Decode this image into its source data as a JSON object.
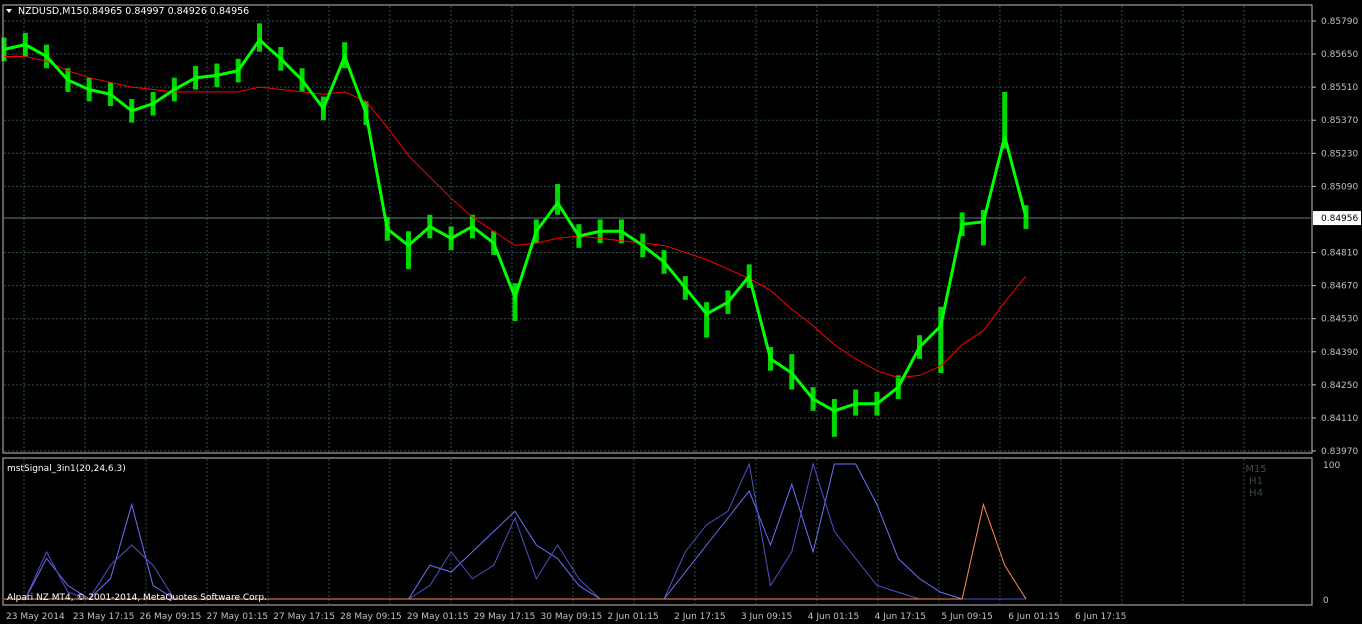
{
  "header": {
    "symbol": "NZDUSD,M15",
    "ohlc": "0.84965 0.84997 0.84926 0.84956"
  },
  "watermark": "Alpari NZ MT4, © 2001-2014, MetaQuotes Software Corp.",
  "colors": {
    "background": "#000000",
    "grid": "#2f4f4f",
    "axis": "#c0c0c0",
    "price_line": "#00ff00",
    "ma_line": "#ff0000",
    "ind_m15": "#6f6fff",
    "ind_h1": "#5050c8",
    "ind_h4": "#ff8c50",
    "label_gray": "#3a4a4a",
    "price_box": "#ffffff"
  },
  "chart_data": [
    {
      "type": "line",
      "symbol": "NZDUSD",
      "timeframe": "M15",
      "current_price": "0.84956",
      "ylim": [
        0.8397,
        0.8579
      ],
      "y_ticks": [
        "0.85790",
        "0.85650",
        "0.85510",
        "0.85370",
        "0.85230",
        "0.85090",
        "0.84810",
        "0.84670",
        "0.84530",
        "0.84390",
        "0.84250",
        "0.84110",
        "0.83970"
      ],
      "x_ticks": [
        "23 May 2014",
        "23 May 17:15",
        "26 May 09:15",
        "27 May 01:15",
        "27 May 17:15",
        "28 May 09:15",
        "29 May 01:15",
        "29 May 17:15",
        "30 May 09:15",
        "2 Jun 01:15",
        "2 Jun 17:15",
        "3 Jun 09:15",
        "4 Jun 01:15",
        "4 Jun 17:15",
        "5 Jun 09:15",
        "6 Jun 01:15",
        "6 Jun 17:15"
      ],
      "x": [
        0,
        5,
        10,
        15,
        20,
        25,
        30,
        35,
        40,
        45,
        50,
        55,
        60,
        65,
        70,
        75,
        80,
        85,
        90,
        95,
        100,
        105,
        110,
        115,
        120,
        125,
        130,
        135,
        140,
        145,
        150,
        155,
        160,
        165,
        170,
        175,
        180,
        185,
        190,
        195,
        200,
        205,
        210,
        215,
        220,
        225,
        230,
        235,
        240
      ],
      "series": [
        {
          "values": [
            0.8567,
            0.8569,
            0.8564,
            0.8554,
            0.855,
            0.8548,
            0.8541,
            0.8544,
            0.855,
            0.8555,
            0.8556,
            0.8558,
            0.8571,
            0.8563,
            0.8554,
            0.8542,
            0.8564,
            0.854,
            0.8491,
            0.8484,
            0.8492,
            0.8487,
            0.8492,
            0.8485,
            0.8462,
            0.849,
            0.8502,
            0.8488,
            0.849,
            0.849,
            0.8484,
            0.8477,
            0.8466,
            0.8455,
            0.846,
            0.8471,
            0.8436,
            0.843,
            0.8419,
            0.8414,
            0.8417,
            0.8417,
            0.8424,
            0.8441,
            0.845,
            0.8493,
            0.8494,
            0.853,
            0.8496
          ],
          "high": [
            0.8572,
            0.8574,
            0.8569,
            0.8559,
            0.8555,
            0.8553,
            0.8546,
            0.8549,
            0.8555,
            0.856,
            0.8561,
            0.8563,
            0.8578,
            0.8568,
            0.8559,
            0.8547,
            0.857,
            0.8545,
            0.8496,
            0.849,
            0.8497,
            0.8492,
            0.8497,
            0.849,
            0.8468,
            0.8495,
            0.851,
            0.8493,
            0.8495,
            0.8495,
            0.8489,
            0.8482,
            0.8471,
            0.846,
            0.8465,
            0.8476,
            0.8441,
            0.8438,
            0.8424,
            0.8419,
            0.8423,
            0.8422,
            0.8429,
            0.8446,
            0.8458,
            0.8498,
            0.8499,
            0.8549,
            0.8501
          ],
          "low": [
            0.8562,
            0.8564,
            0.8559,
            0.8549,
            0.8545,
            0.8543,
            0.8536,
            0.8539,
            0.8545,
            0.855,
            0.8551,
            0.8553,
            0.8566,
            0.8558,
            0.8549,
            0.8537,
            0.8559,
            0.8535,
            0.8486,
            0.8474,
            0.8487,
            0.8482,
            0.8487,
            0.848,
            0.8452,
            0.8485,
            0.8497,
            0.8483,
            0.8485,
            0.8485,
            0.8479,
            0.8472,
            0.8461,
            0.8445,
            0.8455,
            0.8466,
            0.8431,
            0.8423,
            0.8414,
            0.8403,
            0.8412,
            0.8412,
            0.8419,
            0.8436,
            0.843,
            0.8488,
            0.8484,
            0.8525,
            0.8491
          ]
        },
        {
          "values": [
            0.8564,
            0.8564,
            0.8562,
            0.8558,
            0.8555,
            0.8553,
            0.8551,
            0.855,
            0.8549,
            0.8549,
            0.8549,
            0.8549,
            0.8551,
            0.855,
            0.8549,
            0.8548,
            0.8549,
            0.8545,
            0.8534,
            0.8522,
            0.8513,
            0.8504,
            0.8496,
            0.849,
            0.8484,
            0.8485,
            0.8487,
            0.8488,
            0.8487,
            0.8486,
            0.8485,
            0.8484,
            0.8481,
            0.8478,
            0.8474,
            0.847,
            0.8465,
            0.8457,
            0.845,
            0.8442,
            0.8436,
            0.8431,
            0.8428,
            0.8429,
            0.8433,
            0.8442,
            0.8448,
            0.846,
            0.8471
          ]
        }
      ]
    },
    {
      "type": "line",
      "title": "mstSignal_3in1(20,24,6.3)",
      "ylim": [
        0,
        100
      ],
      "y_ticks": [
        "100",
        "0"
      ],
      "legend": [
        "M15",
        "H1",
        "H4"
      ],
      "x": [
        0,
        5,
        10,
        15,
        20,
        25,
        30,
        35,
        40,
        45,
        50,
        55,
        60,
        65,
        70,
        75,
        80,
        85,
        90,
        95,
        100,
        105,
        110,
        115,
        120,
        125,
        130,
        135,
        140,
        145,
        150,
        155,
        160,
        165,
        170,
        175,
        180,
        185,
        190,
        195,
        200,
        205,
        210,
        215,
        220,
        225,
        230,
        235,
        240
      ],
      "series": [
        {
          "name": "M15",
          "values": [
            0,
            0,
            30,
            10,
            0,
            15,
            70,
            10,
            0,
            0,
            0,
            0,
            0,
            0,
            0,
            0,
            0,
            0,
            0,
            0,
            25,
            20,
            35,
            50,
            65,
            40,
            30,
            10,
            0,
            0,
            0,
            0,
            20,
            40,
            60,
            80,
            40,
            85,
            35,
            100,
            100,
            70,
            30,
            15,
            5,
            0,
            0,
            0,
            0
          ]
        },
        {
          "name": "H1",
          "values": [
            0,
            0,
            35,
            5,
            0,
            25,
            40,
            25,
            0,
            0,
            0,
            0,
            0,
            0,
            0,
            0,
            0,
            0,
            0,
            0,
            10,
            35,
            15,
            25,
            60,
            15,
            40,
            15,
            0,
            0,
            0,
            0,
            35,
            55,
            65,
            100,
            10,
            35,
            100,
            50,
            30,
            10,
            5,
            0,
            0,
            0,
            0,
            0,
            0
          ]
        },
        {
          "name": "H4",
          "values": [
            0,
            0,
            0,
            0,
            0,
            0,
            0,
            0,
            0,
            0,
            0,
            0,
            0,
            0,
            0,
            0,
            0,
            0,
            0,
            0,
            0,
            0,
            0,
            0,
            0,
            0,
            0,
            0,
            0,
            0,
            0,
            0,
            0,
            0,
            0,
            0,
            0,
            0,
            0,
            0,
            0,
            0,
            0,
            0,
            0,
            0,
            70,
            25,
            0
          ]
        }
      ]
    }
  ]
}
